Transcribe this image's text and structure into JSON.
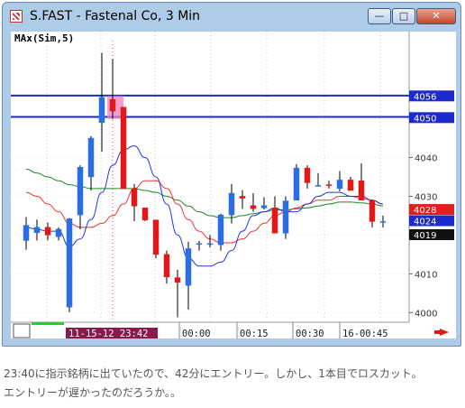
{
  "window": {
    "title": "S.FAST - Fastenal Co, 3 Min",
    "minimize_label": "—",
    "maximize_label": "□",
    "close_label": "✕"
  },
  "indicator_label": "MAx(Sim,5)",
  "price_axis": {
    "labels": [
      "4050",
      "4040",
      "4030",
      "4020",
      "4010",
      "4000"
    ],
    "values": [
      4050,
      4040,
      4030,
      4020,
      4010,
      4000
    ],
    "min": 3997.5,
    "max": 4072.5
  },
  "price_tags": [
    {
      "text": "4056",
      "price": 4055.9,
      "bg": "#1e2acc",
      "fg": "#ffffff"
    },
    {
      "text": "4050",
      "price": 4050.3,
      "bg": "#1e2acc",
      "fg": "#ffffff"
    },
    {
      "text": "4028",
      "price": 4026.6,
      "bg": "#dd2222",
      "fg": "#ffffff"
    },
    {
      "text": "4024",
      "price": 4023.7,
      "bg": "#1e2acc",
      "fg": "#ffffff"
    },
    {
      "text": "4019",
      "price": 4020.1,
      "bg": "#111111",
      "fg": "#ffffff"
    }
  ],
  "horizontal_lines": [
    4056.0,
    4050.5
  ],
  "time_axis": {
    "cursor_label": "11-15-12  23:42",
    "labels": [
      "00:00",
      "00:15",
      "00:30",
      "16-00:45"
    ]
  },
  "colors": {
    "up": "#2a6fe0",
    "down": "#e01818",
    "ma5": "#2233ee",
    "ma_mid": "#ee3333",
    "ma_long": "#228822",
    "hline": "#1e2acc",
    "highlight": "#f57fc0",
    "chart_bg": "#ffffff"
  },
  "chart_data": {
    "type": "candlestick",
    "candles": [
      {
        "o": 4018.6,
        "h": 4024.6,
        "l": 4016.2,
        "c": 4022.5
      },
      {
        "o": 4020.6,
        "h": 4024.0,
        "l": 4018.6,
        "c": 4022.0
      },
      {
        "o": 4022.0,
        "h": 4023.2,
        "l": 4018.6,
        "c": 4020.0
      },
      {
        "o": 4019.6,
        "h": 4022.0,
        "l": 4018.6,
        "c": 4021.5
      },
      {
        "o": 4001.4,
        "h": 4024.4,
        "l": 4000.1,
        "c": 4024.2
      },
      {
        "o": 4025.2,
        "h": 4038.0,
        "l": 4021.5,
        "c": 4037.5
      },
      {
        "o": 4035.0,
        "h": 4045.5,
        "l": 4031.5,
        "c": 4045.0
      },
      {
        "o": 4049.0,
        "h": 4067.0,
        "l": 4041.5,
        "c": 4055.5
      },
      {
        "o": 4055.0,
        "h": 4065.5,
        "l": 4050.0,
        "c": 4052.0
      },
      {
        "o": 4053.0,
        "h": 4052.0,
        "l": 4033.0,
        "c": 4032.0
      },
      {
        "o": 4032.0,
        "h": 4033.2,
        "l": 4023.6,
        "c": 4027.5
      },
      {
        "o": 4027.0,
        "h": 4026.6,
        "l": 4023.6,
        "c": 4023.9
      },
      {
        "o": 4023.9,
        "h": 4023.6,
        "l": 4014.0,
        "c": 4015.0
      },
      {
        "o": 4015.0,
        "h": 4016.0,
        "l": 4007.5,
        "c": 4009.2
      },
      {
        "o": 4009.0,
        "h": 4011.0,
        "l": 3998.8,
        "c": 4007.8
      },
      {
        "o": 4007.0,
        "h": 4018.3,
        "l": 4000.8,
        "c": 4016.5
      },
      {
        "o": 4017.8,
        "h": 4018.5,
        "l": 4016.0,
        "c": 4017.8
      },
      {
        "o": 4017.8,
        "h": 4020.0,
        "l": 4016.8,
        "c": 4017.8
      },
      {
        "o": 4017.5,
        "h": 4025.5,
        "l": 4016.0,
        "c": 4025.2
      },
      {
        "o": 4025.2,
        "h": 4033.2,
        "l": 4023.0,
        "c": 4030.8
      },
      {
        "o": 4030.0,
        "h": 4031.6,
        "l": 4026.8,
        "c": 4029.5
      },
      {
        "o": 4027.6,
        "h": 4030.8,
        "l": 4026.0,
        "c": 4026.8
      },
      {
        "o": 4027.0,
        "h": 4029.8,
        "l": 4026.6,
        "c": 4027.6
      },
      {
        "o": 4027.0,
        "h": 4030.0,
        "l": 4020.5,
        "c": 4020.5
      },
      {
        "o": 4020.5,
        "h": 4030.0,
        "l": 4019.0,
        "c": 4028.8
      },
      {
        "o": 4029.0,
        "h": 4038.3,
        "l": 4029.0,
        "c": 4037.3
      },
      {
        "o": 4037.3,
        "h": 4038.0,
        "l": 4032.0,
        "c": 4033.5
      },
      {
        "o": 4032.8,
        "h": 4036.0,
        "l": 4032.8,
        "c": 4032.8
      },
      {
        "o": 4033.0,
        "h": 4034.0,
        "l": 4032.0,
        "c": 4032.8
      },
      {
        "o": 4032.0,
        "h": 4036.5,
        "l": 4031.3,
        "c": 4034.2
      },
      {
        "o": 4034.2,
        "h": 4035.0,
        "l": 4031.5,
        "c": 4031.5
      },
      {
        "o": 4034.0,
        "h": 4038.5,
        "l": 4031.5,
        "c": 4029.0
      },
      {
        "o": 4029.0,
        "h": 4029.0,
        "l": 4022.0,
        "c": 4023.5
      },
      {
        "o": 4023.5,
        "h": 4025.0,
        "l": 4022.0,
        "c": 4023.5
      }
    ],
    "ma5": [
      4022,
      4021.5,
      4021,
      4021,
      4017,
      4019,
      4024,
      4031,
      4038,
      4042,
      4043,
      4040,
      4035,
      4028,
      4020,
      4014,
      4012,
      4012,
      4013,
      4016,
      4021,
      4025,
      4026,
      4027,
      4026,
      4026,
      4028,
      4030,
      4031,
      4031,
      4030,
      4030,
      4029,
      4028
    ],
    "ma_mid": [
      4031,
      4030,
      4028,
      4026,
      4023,
      4022,
      4022,
      4023,
      4025,
      4028,
      4032,
      4034,
      4034,
      4032,
      4028,
      4024,
      4021,
      4019,
      4018,
      4018,
      4019,
      4021,
      4023,
      4025,
      4026,
      4027,
      4028,
      4029,
      4029,
      4030,
      4030,
      4029.5,
      4029,
      4028
    ],
    "ma_long": [
      4037,
      4036,
      4035,
      4034,
      4033,
      4032.5,
      4032,
      4032,
      4032,
      4032,
      4032,
      4031.5,
      4031,
      4030,
      4029,
      4027.5,
      4026,
      4025,
      4024.5,
      4024.5,
      4025,
      4025.5,
      4026,
      4026.5,
      4026.5,
      4026.8,
      4027,
      4027.5,
      4028,
      4028.5,
      4028.5,
      4028.3,
      4028,
      4027.5
    ],
    "entry_index": 8,
    "highlight_range": [
      4050.0,
      4055.9
    ],
    "ylim": [
      3997.5,
      4072.5
    ]
  },
  "caption": "23:40に指示銘柄に出ていたので、42分にエントリー。しかし、1本目でロスカット。\nエントリーが遅かったのだろうか。。"
}
